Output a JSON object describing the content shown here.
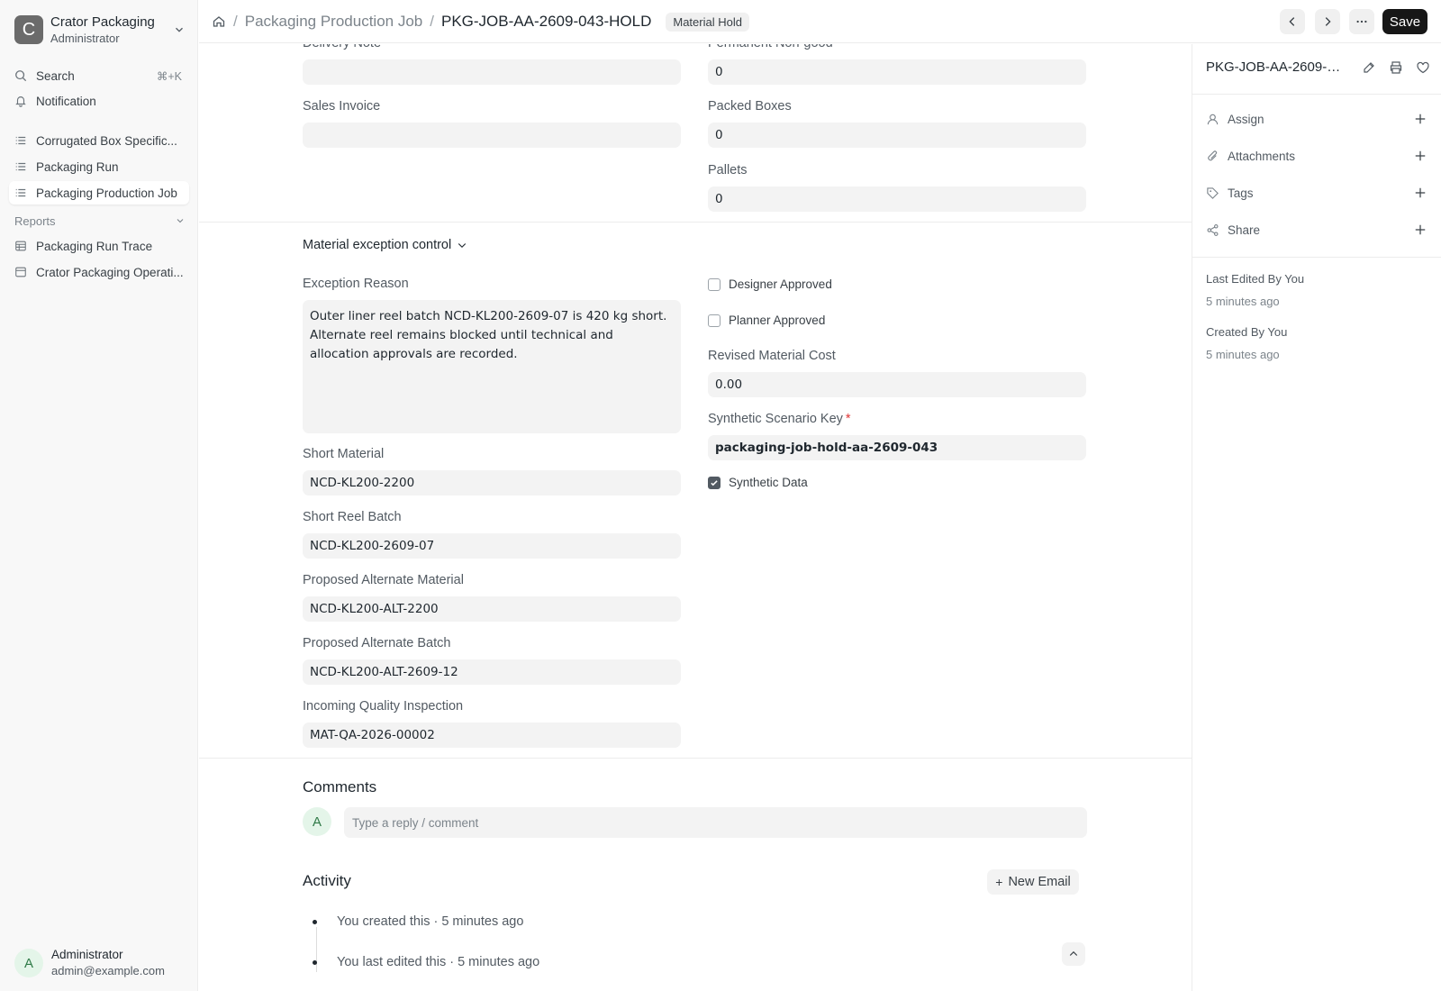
{
  "workspace": {
    "logo_letter": "C",
    "name": "Crator Packaging",
    "role": "Administrator"
  },
  "sidebar": {
    "search_label": "Search",
    "search_shortcut": "⌘+K",
    "notification_label": "Notification",
    "items": [
      {
        "label": "Corrugated Box Specific..."
      },
      {
        "label": "Packaging Run"
      },
      {
        "label": "Packaging Production Job"
      }
    ],
    "reports_label": "Reports",
    "reports": [
      {
        "label": "Packaging Run Trace"
      },
      {
        "label": "Crator Packaging Operati..."
      }
    ]
  },
  "user": {
    "avatar_letter": "A",
    "name": "Administrator",
    "email": "admin@example.com"
  },
  "header": {
    "breadcrumb_parent": "Packaging Production Job",
    "breadcrumb_current": "PKG-JOB-AA-2609-043-HOLD",
    "status_badge": "Material Hold",
    "save_label": "Save"
  },
  "form": {
    "delivery_note": {
      "label": "Delivery Note",
      "value": ""
    },
    "permanent_non_good": {
      "label": "Permanent Non-good",
      "value": "0"
    },
    "sales_invoice": {
      "label": "Sales Invoice",
      "value": ""
    },
    "packed_boxes": {
      "label": "Packed Boxes",
      "value": "0"
    },
    "pallets": {
      "label": "Pallets",
      "value": "0"
    },
    "section_title": "Material exception control",
    "exception_reason": {
      "label": "Exception Reason",
      "value": "Outer liner reel batch NCD-KL200-2609-07 is 420 kg short. Alternate reel remains blocked until technical and allocation approvals are recorded."
    },
    "designer_approved": {
      "label": "Designer Approved",
      "checked": false
    },
    "planner_approved": {
      "label": "Planner Approved",
      "checked": false
    },
    "revised_material_cost": {
      "label": "Revised Material Cost",
      "value": "0.00"
    },
    "synthetic_scenario_key": {
      "label": "Synthetic Scenario Key",
      "required_mark": "*",
      "value": "packaging-job-hold-aa-2609-043"
    },
    "synthetic_data": {
      "label": "Synthetic Data",
      "checked": true
    },
    "short_material": {
      "label": "Short Material",
      "value": "NCD-KL200-2200"
    },
    "short_reel_batch": {
      "label": "Short Reel Batch",
      "value": "NCD-KL200-2609-07"
    },
    "proposed_alternate_material": {
      "label": "Proposed Alternate Material",
      "value": "NCD-KL200-ALT-2200"
    },
    "proposed_alternate_batch": {
      "label": "Proposed Alternate Batch",
      "value": "NCD-KL200-ALT-2609-12"
    },
    "incoming_quality_inspection": {
      "label": "Incoming Quality Inspection",
      "value": "MAT-QA-2026-00002"
    }
  },
  "comments": {
    "title": "Comments",
    "avatar_letter": "A",
    "placeholder": "Type a reply / comment"
  },
  "activity": {
    "title": "Activity",
    "new_email_label": "New Email",
    "items": [
      {
        "text": "You created this · 5 minutes ago"
      },
      {
        "text": "You last edited this · 5 minutes ago"
      }
    ]
  },
  "right_sidebar": {
    "doc_title": "PKG-JOB-AA-2609-043-HOLD",
    "assign_label": "Assign",
    "attachments_label": "Attachments",
    "tags_label": "Tags",
    "share_label": "Share",
    "last_edited_label": "Last Edited By You",
    "last_edited_time": "5 minutes ago",
    "created_label": "Created By You",
    "created_time": "5 minutes ago"
  }
}
